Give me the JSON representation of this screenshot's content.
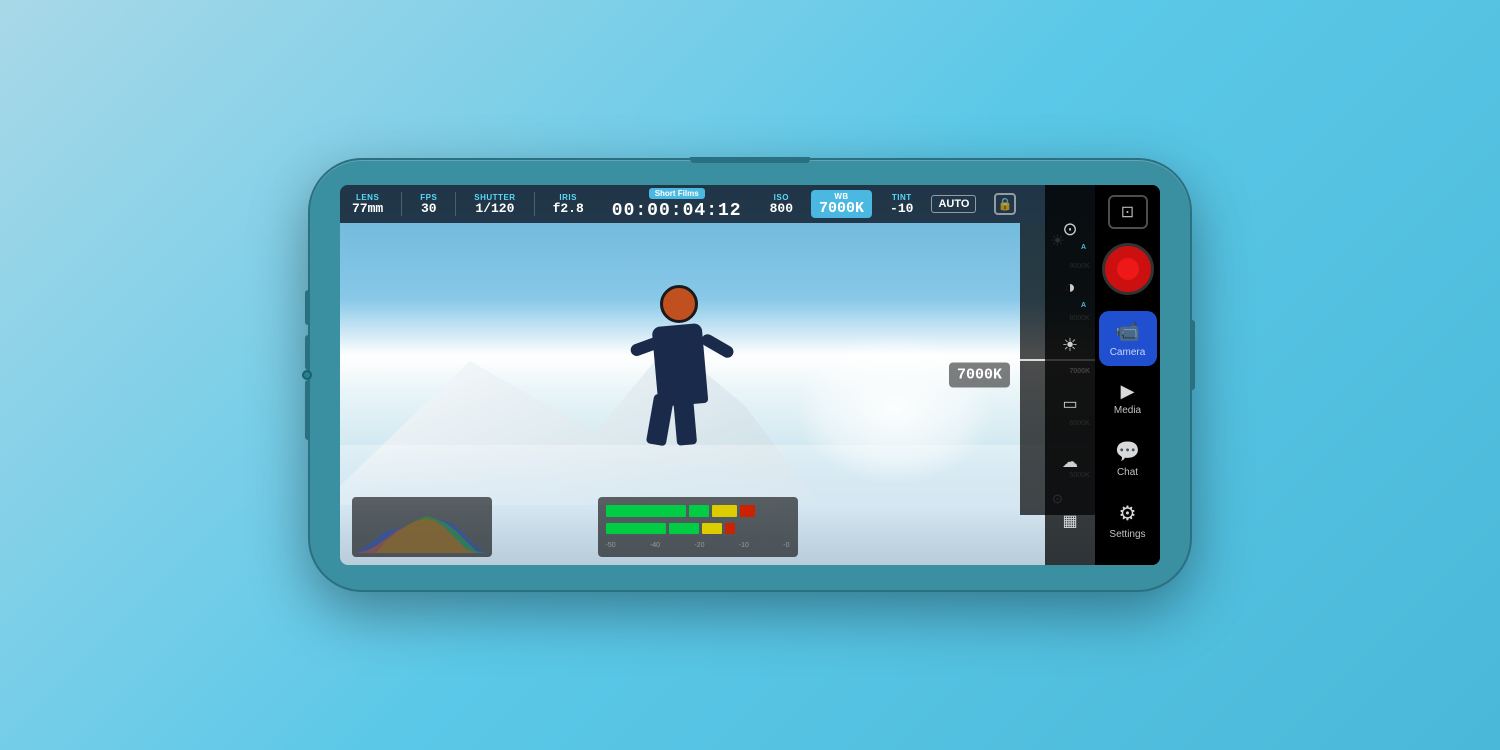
{
  "background": {
    "gradient_start": "#a8d8e8",
    "gradient_end": "#4ab8d8"
  },
  "phone": {
    "color": "#3a8fa0"
  },
  "hud": {
    "lens_label": "LENS",
    "lens_value": "77mm",
    "fps_label": "FPS",
    "fps_value": "30",
    "shutter_label": "SHUTTER",
    "shutter_value": "1/120",
    "iris_label": "IRIS",
    "iris_value": "f2.8",
    "preset_badge": "Short Films",
    "timecode": "00:00:04:12",
    "iso_label": "ISO",
    "iso_value": "800",
    "wb_label": "WB",
    "wb_value": "7000K",
    "tint_label": "TINT",
    "tint_value": "-10",
    "auto_label": "AUTO",
    "wb_current": "7000K"
  },
  "wb_scale": {
    "labels": [
      "9000K",
      "8000K",
      "7000K",
      "6000K",
      "5000K"
    ]
  },
  "nav": {
    "items": [
      {
        "id": "camera",
        "label": "Camera",
        "icon": "📹",
        "active": true
      },
      {
        "id": "media",
        "label": "Media",
        "icon": "▶",
        "active": false
      },
      {
        "id": "chat",
        "label": "Chat",
        "icon": "💬",
        "active": false
      },
      {
        "id": "settings",
        "label": "Settings",
        "icon": "⚙",
        "active": false
      }
    ]
  },
  "side_icons": {
    "icons": [
      {
        "id": "af-icon",
        "symbol": "⊙",
        "label": "AF"
      },
      {
        "id": "exposure-icon",
        "symbol": "◑",
        "label": "Exposure"
      },
      {
        "id": "wb-scene-icon",
        "symbol": "☀",
        "label": "WB"
      },
      {
        "id": "gallery-icon",
        "symbol": "□",
        "label": "Gallery"
      },
      {
        "id": "cloud-icon",
        "symbol": "☁",
        "label": "Cloud"
      },
      {
        "id": "grid-icon",
        "symbol": "▦",
        "label": "Grid"
      }
    ]
  },
  "outer_top_icon": "⊡"
}
